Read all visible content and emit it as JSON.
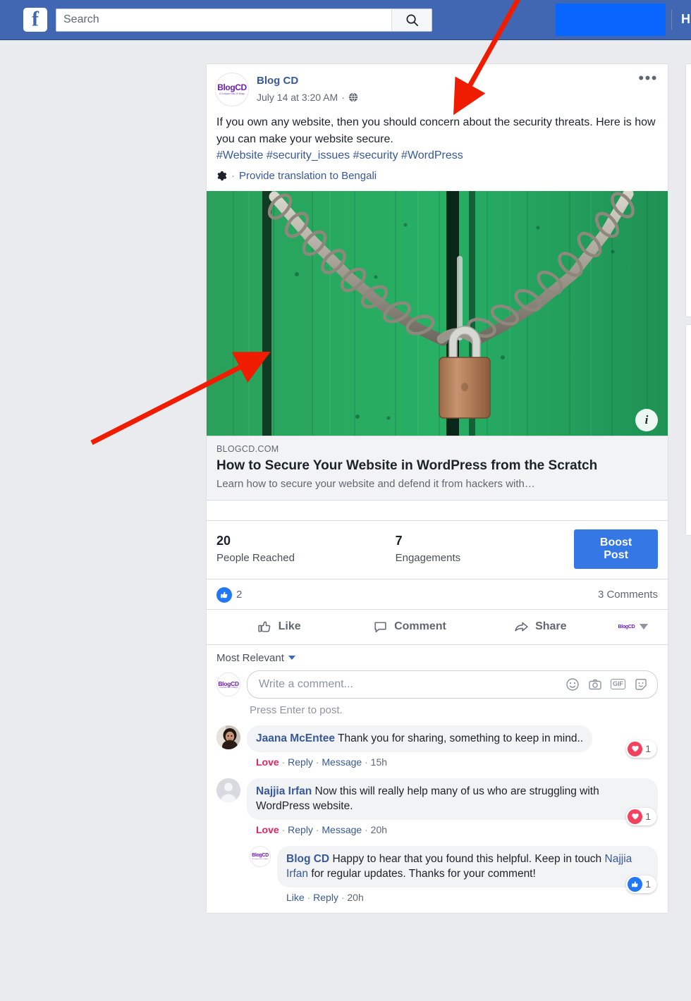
{
  "topbar": {
    "logo_letter": "f",
    "search_placeholder": "Search",
    "search_value": "",
    "search_icon": "magnifier-icon",
    "home_label": "H"
  },
  "post": {
    "page_name": "Blog CD",
    "timestamp": "July 14 at 3:20 AM",
    "privacy_icon": "globe-icon",
    "separator": "·",
    "more_label": "•••",
    "avatar_logo": "BlogCD",
    "avatar_tagline": "A Compact Disc Of Blogs",
    "text": "If you own any website, then you should concern about the security threats. Here is how you can make your website secure.",
    "hashtags": "#Website #security_issues #security #WordPress",
    "translate_label": "Provide translation to Bengali",
    "translate_icon": "gear-icon",
    "photo_alt": "green wooden door chained shut with a brass padlock",
    "info_button": "i"
  },
  "link_preview": {
    "domain": "BLOGCD.COM",
    "title": "How to Secure Your Website in WordPress from the Scratch",
    "description": "Learn how to secure your website and defend it from hackers with…"
  },
  "insights": {
    "reach_value": "20",
    "reach_label": "People Reached",
    "engagements_value": "7",
    "engagements_label": "Engagements",
    "boost_label": "Boost Post"
  },
  "reactions": {
    "like_count": "2",
    "comments_count": "3 Comments"
  },
  "actions": {
    "like": "Like",
    "comment": "Comment",
    "share": "Share",
    "share_as_logo": "BlogCD",
    "share_caret": "chevron-down-icon"
  },
  "comment_section": {
    "sort_label": "Most Relevant",
    "composer_placeholder": "Write a comment...",
    "composer_value": "",
    "composer_icons": [
      "emoji-icon",
      "camera-icon",
      "gif-icon",
      "sticker-icon"
    ],
    "gif_label": "GIF",
    "press_enter": "Press Enter to post.",
    "comments": [
      {
        "author": "Jaana McEntee",
        "text": " Thank you for sharing, something to keep in mind..",
        "reaction_verb": "Love",
        "reply": "Reply",
        "message": "Message",
        "time": "15h",
        "badge_icon": "heart-icon",
        "badge_count": "1",
        "avatar_type": "photo"
      },
      {
        "author": "Najjia Irfan",
        "text": " Now this will really help many of us who are struggling with WordPress website.",
        "reaction_verb": "Love",
        "reply": "Reply",
        "message": "Message",
        "time": "20h",
        "badge_icon": "heart-icon",
        "badge_count": "1",
        "avatar_type": "silhouette"
      },
      {
        "author": "Blog CD",
        "text_before": " Happy to hear that you found this helpful. Keep in touch ",
        "mention": "Najjia Irfan",
        "text_after": " for regular updates. Thanks for your comment!",
        "reaction_verb": "Like",
        "reply": "Reply",
        "time": "20h",
        "badge_icon": "thumbs-up-icon",
        "badge_count": "1",
        "avatar_type": "blogcd",
        "nested": true
      }
    ]
  },
  "colors": {
    "fb_blue": "#4267b2",
    "accent_blue": "#3578e5",
    "link_blue": "#385898",
    "love_red": "#e0245e",
    "page_bg": "#e9ebee",
    "annotation_arrow": "#f01c00"
  }
}
